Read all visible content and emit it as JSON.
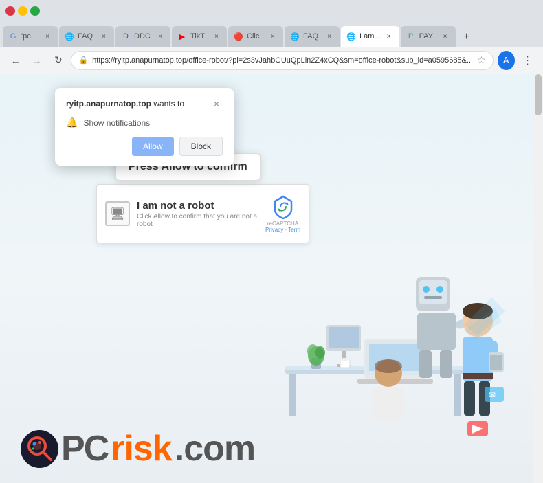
{
  "browser": {
    "window_controls": {
      "close": "×",
      "min": "−",
      "max": "□"
    },
    "tabs": [
      {
        "id": "tab1",
        "favicon": "G",
        "favicon_color": "#4285f4",
        "label": "'pc...",
        "active": false
      },
      {
        "id": "tab2",
        "favicon": "❓",
        "favicon_color": "#e67e22",
        "label": "FAQ",
        "active": false
      },
      {
        "id": "tab3",
        "favicon": "D",
        "favicon_color": "#1565c0",
        "label": "DDC",
        "active": false
      },
      {
        "id": "tab4",
        "favicon": "▶",
        "favicon_color": "#ff0000",
        "label": "TikT",
        "active": false
      },
      {
        "id": "tab5",
        "favicon": "C",
        "favicon_color": "#e74c3c",
        "label": "Click",
        "active": false
      },
      {
        "id": "tab6",
        "favicon": "❓",
        "favicon_color": "#e67e22",
        "label": "FAQ",
        "active": false
      },
      {
        "id": "tab7",
        "favicon": "I",
        "favicon_color": "#3498db",
        "label": "I am...",
        "active": true
      },
      {
        "id": "tab8",
        "favicon": "P",
        "favicon_color": "#27ae60",
        "label": "PAY",
        "active": false
      }
    ],
    "nav": {
      "back_disabled": false,
      "forward_disabled": true,
      "reload": "↻"
    },
    "url": "https://ryitp.anapurnatop.top/office-robot/?pl=2s3vJahbGUuQpLln2Z4xCQ&sm=office-robot&sub_id=a0595685&...",
    "url_short": "https://ryitp.anapurnatop.top/office-robot/?pl=2s3vJahbGUuQpLln2Z4xCQ&sm=office-robot&sub_id=a0595685&..."
  },
  "notification_popup": {
    "site_bold": "ryitp.anapurnatop.top",
    "site_suffix": " wants to",
    "permission_icon": "🔔",
    "permission_text": "Show notifications",
    "allow_label": "Allow",
    "block_label": "Block",
    "close_icon": "×"
  },
  "press_allow": {
    "text": "Press Allow to confirm"
  },
  "captcha": {
    "title": "I am not a robot",
    "subtitle": "Click Allow to confirm that you are not a robot",
    "recaptcha_label": "reCAPTCHA",
    "privacy": "Privacy",
    "terms": "Term"
  },
  "pcrisk": {
    "pc_text": "PC",
    "risk_text": "risk",
    "com_text": ".com"
  }
}
